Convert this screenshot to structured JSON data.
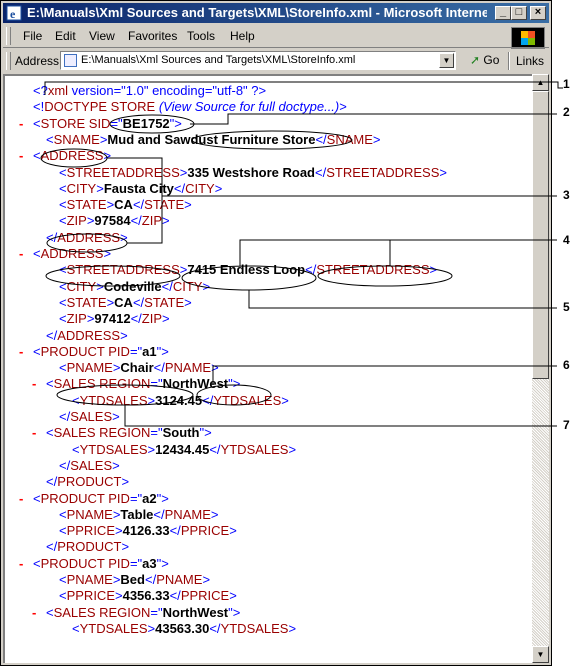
{
  "window": {
    "title": "E:\\Manuals\\Xml Sources and Targets\\XML\\StoreInfo.xml - Microsoft Internet Ex...",
    "min_glyph": "_",
    "max_glyph": "□",
    "close_glyph": "×"
  },
  "menu": [
    "File",
    "Edit",
    "View",
    "Favorites",
    "Tools",
    "Help"
  ],
  "address": {
    "label": "Address",
    "value": "E:\\Manuals\\Xml Sources and Targets\\XML\\StoreInfo.xml",
    "go_label": "Go",
    "links_label": "Links"
  },
  "xml_lines": [
    {
      "indent": 0,
      "minus": false,
      "parts": [
        [
          "b",
          "<?"
        ],
        [
          "r",
          "xml"
        ],
        [
          "b",
          " version=\"1.0\" encoding=\"utf-8\" ?>"
        ]
      ]
    },
    {
      "indent": 0,
      "minus": false,
      "parts": [
        [
          "b",
          "<!"
        ],
        [
          "r",
          "DOCTYPE STORE"
        ],
        [
          "c",
          " (View Source for full doctype...)"
        ],
        [
          "b",
          ">"
        ]
      ]
    },
    {
      "indent": 0,
      "minus": true,
      "parts": [
        [
          "b",
          "<"
        ],
        [
          "r",
          "STORE"
        ],
        [
          "r",
          " SID"
        ],
        [
          "b",
          "=\""
        ],
        [
          "v",
          "BE1752"
        ],
        [
          "b",
          "\">"
        ]
      ]
    },
    {
      "indent": 1,
      "minus": false,
      "parts": [
        [
          "b",
          "<"
        ],
        [
          "r",
          "SNAME"
        ],
        [
          "b",
          ">"
        ],
        [
          "v",
          "Mud and Sawdust Furniture Store"
        ],
        [
          "b",
          "</"
        ],
        [
          "r",
          "SNAME"
        ],
        [
          "b",
          ">"
        ]
      ]
    },
    {
      "indent": 0,
      "minus": true,
      "parts": [
        [
          "b",
          "<"
        ],
        [
          "r",
          "ADDRESS"
        ],
        [
          "b",
          ">"
        ]
      ]
    },
    {
      "indent": 2,
      "minus": false,
      "parts": [
        [
          "b",
          "<"
        ],
        [
          "r",
          "STREETADDRESS"
        ],
        [
          "b",
          ">"
        ],
        [
          "v",
          "335 Westshore Road"
        ],
        [
          "b",
          "</"
        ],
        [
          "r",
          "STREETADDRESS"
        ],
        [
          "b",
          ">"
        ]
      ]
    },
    {
      "indent": 2,
      "minus": false,
      "parts": [
        [
          "b",
          "<"
        ],
        [
          "r",
          "CITY"
        ],
        [
          "b",
          ">"
        ],
        [
          "v",
          "Fausta City"
        ],
        [
          "b",
          "</"
        ],
        [
          "r",
          "CITY"
        ],
        [
          "b",
          ">"
        ]
      ]
    },
    {
      "indent": 2,
      "minus": false,
      "parts": [
        [
          "b",
          "<"
        ],
        [
          "r",
          "STATE"
        ],
        [
          "b",
          ">"
        ],
        [
          "v",
          "CA"
        ],
        [
          "b",
          "</"
        ],
        [
          "r",
          "STATE"
        ],
        [
          "b",
          ">"
        ]
      ]
    },
    {
      "indent": 2,
      "minus": false,
      "parts": [
        [
          "b",
          "<"
        ],
        [
          "r",
          "ZIP"
        ],
        [
          "b",
          ">"
        ],
        [
          "v",
          "97584"
        ],
        [
          "b",
          "</"
        ],
        [
          "r",
          "ZIP"
        ],
        [
          "b",
          ">"
        ]
      ]
    },
    {
      "indent": 1,
      "minus": false,
      "parts": [
        [
          "b",
          "</"
        ],
        [
          "r",
          "ADDRESS"
        ],
        [
          "b",
          ">"
        ]
      ]
    },
    {
      "indent": 0,
      "minus": true,
      "parts": [
        [
          "b",
          "<"
        ],
        [
          "r",
          "ADDRESS"
        ],
        [
          "b",
          ">"
        ]
      ]
    },
    {
      "indent": 2,
      "minus": false,
      "parts": [
        [
          "b",
          "<"
        ],
        [
          "r",
          "STREETADDRESS"
        ],
        [
          "b",
          ">"
        ],
        [
          "v",
          "7415 Endless Loop"
        ],
        [
          "b",
          "</"
        ],
        [
          "r",
          "STREETADDRESS"
        ],
        [
          "b",
          ">"
        ]
      ]
    },
    {
      "indent": 2,
      "minus": false,
      "parts": [
        [
          "b",
          "<"
        ],
        [
          "r",
          "CITY"
        ],
        [
          "b",
          ">"
        ],
        [
          "v",
          "Codeville"
        ],
        [
          "b",
          "</"
        ],
        [
          "r",
          "CITY"
        ],
        [
          "b",
          ">"
        ]
      ]
    },
    {
      "indent": 2,
      "minus": false,
      "parts": [
        [
          "b",
          "<"
        ],
        [
          "r",
          "STATE"
        ],
        [
          "b",
          ">"
        ],
        [
          "v",
          "CA"
        ],
        [
          "b",
          "</"
        ],
        [
          "r",
          "STATE"
        ],
        [
          "b",
          ">"
        ]
      ]
    },
    {
      "indent": 2,
      "minus": false,
      "parts": [
        [
          "b",
          "<"
        ],
        [
          "r",
          "ZIP"
        ],
        [
          "b",
          ">"
        ],
        [
          "v",
          "97412"
        ],
        [
          "b",
          "</"
        ],
        [
          "r",
          "ZIP"
        ],
        [
          "b",
          ">"
        ]
      ]
    },
    {
      "indent": 1,
      "minus": false,
      "parts": [
        [
          "b",
          "</"
        ],
        [
          "r",
          "ADDRESS"
        ],
        [
          "b",
          ">"
        ]
      ]
    },
    {
      "indent": 0,
      "minus": true,
      "parts": [
        [
          "b",
          "<"
        ],
        [
          "r",
          "PRODUCT"
        ],
        [
          "r",
          " PID"
        ],
        [
          "b",
          "=\""
        ],
        [
          "v",
          "a1"
        ],
        [
          "b",
          "\">"
        ]
      ]
    },
    {
      "indent": 2,
      "minus": false,
      "parts": [
        [
          "b",
          "<"
        ],
        [
          "r",
          "PNAME"
        ],
        [
          "b",
          ">"
        ],
        [
          "v",
          "Chair"
        ],
        [
          "b",
          "</"
        ],
        [
          "r",
          "PNAME"
        ],
        [
          "b",
          ">"
        ]
      ]
    },
    {
      "indent": 1,
      "minus": true,
      "parts": [
        [
          "b",
          "<"
        ],
        [
          "r",
          "SALES"
        ],
        [
          "r",
          " REGION"
        ],
        [
          "b",
          "=\""
        ],
        [
          "v",
          "NorthWest"
        ],
        [
          "b",
          "\">"
        ]
      ]
    },
    {
      "indent": 3,
      "minus": false,
      "parts": [
        [
          "b",
          "<"
        ],
        [
          "r",
          "YTDSALES"
        ],
        [
          "b",
          ">"
        ],
        [
          "v",
          "3124.45"
        ],
        [
          "b",
          "</"
        ],
        [
          "r",
          "YTDSALES"
        ],
        [
          "b",
          ">"
        ]
      ]
    },
    {
      "indent": 2,
      "minus": false,
      "parts": [
        [
          "b",
          "</"
        ],
        [
          "r",
          "SALES"
        ],
        [
          "b",
          ">"
        ]
      ]
    },
    {
      "indent": 1,
      "minus": true,
      "parts": [
        [
          "b",
          "<"
        ],
        [
          "r",
          "SALES"
        ],
        [
          "r",
          " REGION"
        ],
        [
          "b",
          "=\""
        ],
        [
          "v",
          "South"
        ],
        [
          "b",
          "\">"
        ]
      ]
    },
    {
      "indent": 3,
      "minus": false,
      "parts": [
        [
          "b",
          "<"
        ],
        [
          "r",
          "YTDSALES"
        ],
        [
          "b",
          ">"
        ],
        [
          "v",
          "12434.45"
        ],
        [
          "b",
          "</"
        ],
        [
          "r",
          "YTDSALES"
        ],
        [
          "b",
          ">"
        ]
      ]
    },
    {
      "indent": 2,
      "minus": false,
      "parts": [
        [
          "b",
          "</"
        ],
        [
          "r",
          "SALES"
        ],
        [
          "b",
          ">"
        ]
      ]
    },
    {
      "indent": 1,
      "minus": false,
      "parts": [
        [
          "b",
          "</"
        ],
        [
          "r",
          "PRODUCT"
        ],
        [
          "b",
          ">"
        ]
      ]
    },
    {
      "indent": 0,
      "minus": true,
      "parts": [
        [
          "b",
          "<"
        ],
        [
          "r",
          "PRODUCT"
        ],
        [
          "r",
          " PID"
        ],
        [
          "b",
          "=\""
        ],
        [
          "v",
          "a2"
        ],
        [
          "b",
          "\">"
        ]
      ]
    },
    {
      "indent": 2,
      "minus": false,
      "parts": [
        [
          "b",
          "<"
        ],
        [
          "r",
          "PNAME"
        ],
        [
          "b",
          ">"
        ],
        [
          "v",
          "Table"
        ],
        [
          "b",
          "</"
        ],
        [
          "r",
          "PNAME"
        ],
        [
          "b",
          ">"
        ]
      ]
    },
    {
      "indent": 2,
      "minus": false,
      "parts": [
        [
          "b",
          "<"
        ],
        [
          "r",
          "PPRICE"
        ],
        [
          "b",
          ">"
        ],
        [
          "v",
          "4126.33"
        ],
        [
          "b",
          "</"
        ],
        [
          "r",
          "PPRICE"
        ],
        [
          "b",
          ">"
        ]
      ]
    },
    {
      "indent": 1,
      "minus": false,
      "parts": [
        [
          "b",
          "</"
        ],
        [
          "r",
          "PRODUCT"
        ],
        [
          "b",
          ">"
        ]
      ]
    },
    {
      "indent": 0,
      "minus": true,
      "parts": [
        [
          "b",
          "<"
        ],
        [
          "r",
          "PRODUCT"
        ],
        [
          "r",
          " PID"
        ],
        [
          "b",
          "=\""
        ],
        [
          "v",
          "a3"
        ],
        [
          "b",
          "\">"
        ]
      ]
    },
    {
      "indent": 2,
      "minus": false,
      "parts": [
        [
          "b",
          "<"
        ],
        [
          "r",
          "PNAME"
        ],
        [
          "b",
          ">"
        ],
        [
          "v",
          "Bed"
        ],
        [
          "b",
          "</"
        ],
        [
          "r",
          "PNAME"
        ],
        [
          "b",
          ">"
        ]
      ]
    },
    {
      "indent": 2,
      "minus": false,
      "parts": [
        [
          "b",
          "<"
        ],
        [
          "r",
          "PPRICE"
        ],
        [
          "b",
          ">"
        ],
        [
          "v",
          "4356.33"
        ],
        [
          "b",
          "</"
        ],
        [
          "r",
          "PPRICE"
        ],
        [
          "b",
          ">"
        ]
      ]
    },
    {
      "indent": 1,
      "minus": true,
      "parts": [
        [
          "b",
          "<"
        ],
        [
          "r",
          "SALES"
        ],
        [
          "r",
          " REGION"
        ],
        [
          "b",
          "=\""
        ],
        [
          "v",
          "NorthWest"
        ],
        [
          "b",
          "\">"
        ]
      ]
    },
    {
      "indent": 3,
      "minus": false,
      "parts": [
        [
          "b",
          "<"
        ],
        [
          "r",
          "YTDSALES"
        ],
        [
          "b",
          ">"
        ],
        [
          "v",
          "43563.30"
        ],
        [
          "b",
          "</"
        ],
        [
          "r",
          "YTDSALES"
        ],
        [
          "b",
          ">"
        ]
      ]
    }
  ],
  "callouts": [
    "1",
    "2",
    "3",
    "4",
    "5",
    "6",
    "7"
  ]
}
